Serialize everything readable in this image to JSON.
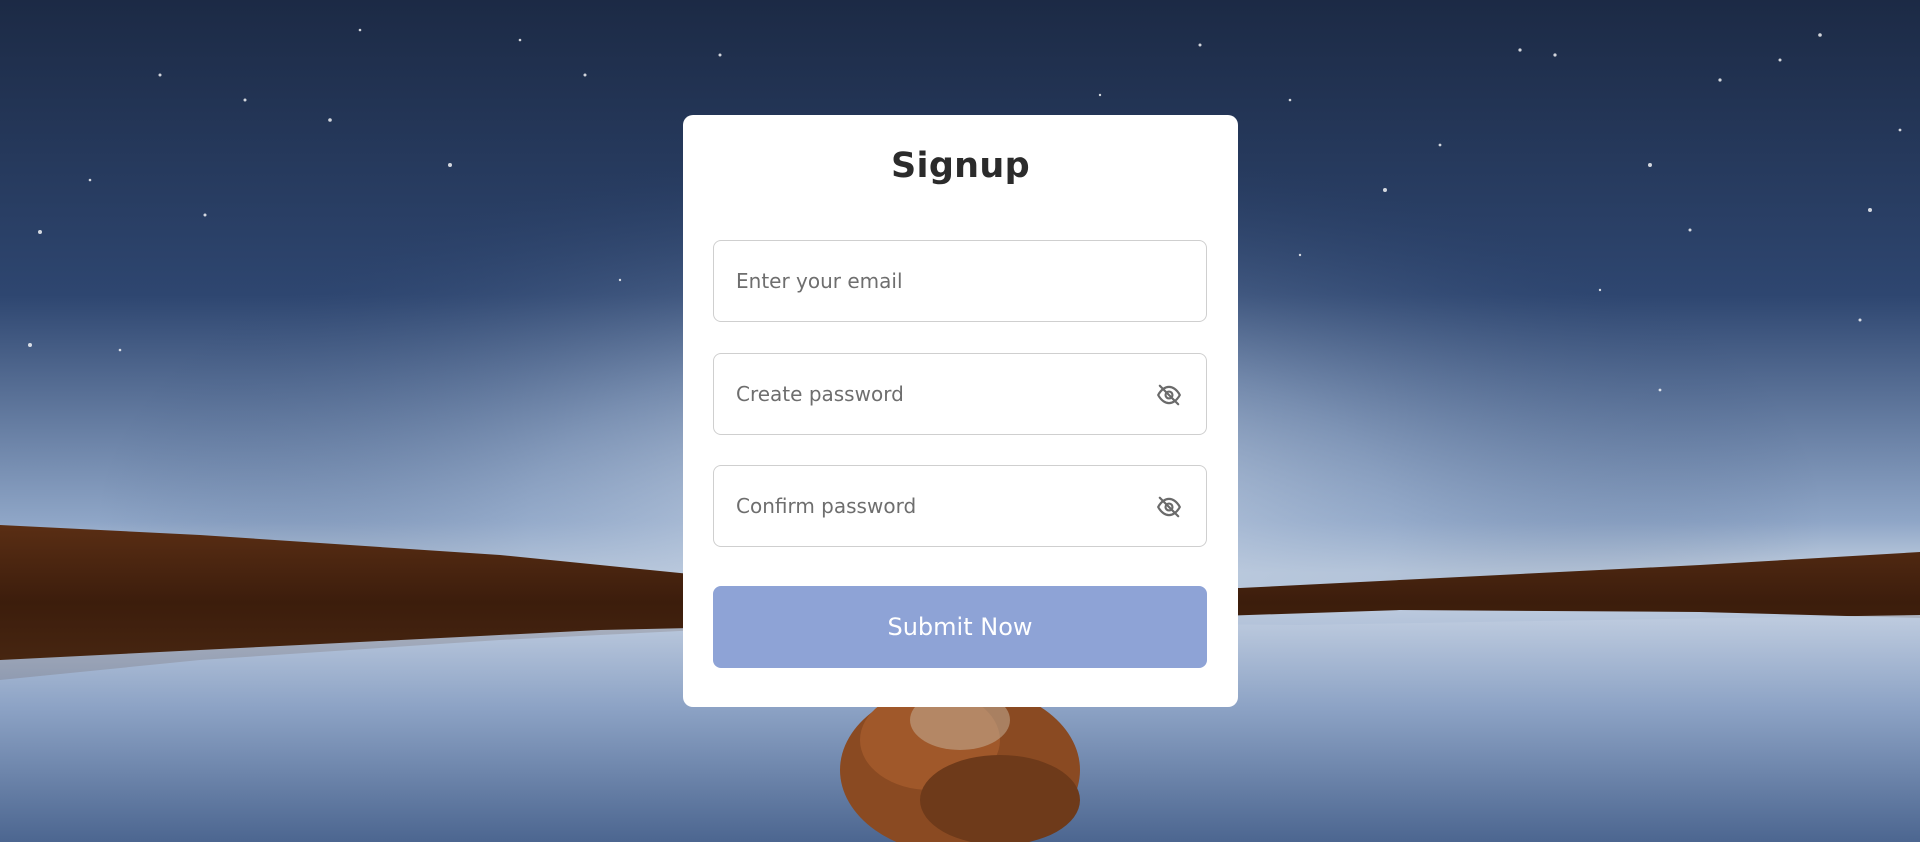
{
  "form": {
    "title": "Signup",
    "email_placeholder": "Enter your email",
    "password_placeholder": "Create password",
    "confirm_placeholder": "Confirm password",
    "submit_label": "Submit Now"
  },
  "colors": {
    "button": "#8ea3d6",
    "card": "#ffffff",
    "field_border": "#cfcfcf",
    "title": "#2b2b2b"
  },
  "icons": {
    "password_toggle": "eye-slash-icon",
    "confirm_toggle": "eye-slash-icon"
  }
}
